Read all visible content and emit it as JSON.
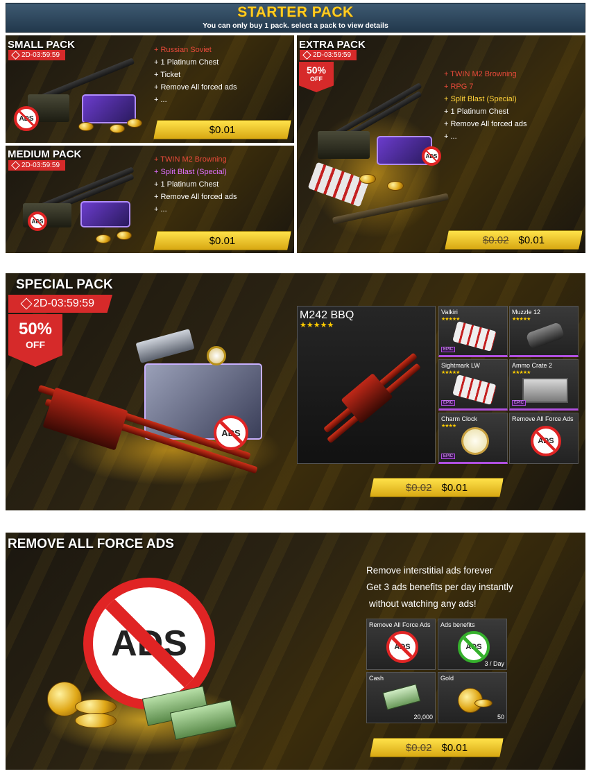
{
  "header": {
    "title": "STARTER PACK",
    "subtitle": "You can only buy 1 pack. select a pack to view details"
  },
  "small_pack": {
    "title": "SMALL PACK",
    "timer": "2D-03:59:59",
    "items": [
      "+ Russian Soviet",
      "+ 1 Platinum Chest",
      "+ Ticket",
      "+ Remove All forced ads",
      "+ ..."
    ],
    "price": "$0.01",
    "ads_icon_text": "ADS"
  },
  "medium_pack": {
    "title": "MEDIUM PACK",
    "timer": "2D-03:59:59",
    "items": [
      "+ TWIN M2 Browning",
      "+ Split Blast (Special)",
      "+ 1 Platinum Chest",
      "+ Remove All forced ads",
      "+ ..."
    ],
    "price": "$0.01",
    "ads_icon_text": "ADS"
  },
  "extra_pack": {
    "title": "EXTRA PACK",
    "timer": "2D-03:59:59",
    "discount_pct": "50%",
    "discount_off": "OFF",
    "items": [
      "+ TWIN M2 Browning",
      "+ RPG 7",
      "+ Split Blast (Special)",
      "+ 1 Platinum Chest",
      "+ Remove All forced ads",
      "+ ..."
    ],
    "old_price": "$0.02",
    "price": "$0.01",
    "ads_icon_text": "ADS"
  },
  "special_pack": {
    "title": "SPECIAL PACK",
    "timer": "2D-03:59:59",
    "discount_pct": "50%",
    "discount_off": "OFF",
    "main_item": {
      "name": "M242 BBQ",
      "stars": "★★★★★"
    },
    "grid": [
      {
        "name": "Valkiri",
        "stars": "★★★★★",
        "tag": "EPIC"
      },
      {
        "name": "Muzzle 12",
        "stars": "★★★★★",
        "tag": ""
      },
      {
        "name": "Sightmark LW",
        "stars": "★★★★★",
        "tag": "EPIC"
      },
      {
        "name": "Ammo Crate 2",
        "stars": "★★★★★",
        "tag": "EPIC"
      },
      {
        "name": "Charm Clock",
        "stars": "★★★★",
        "tag": "EPIC"
      },
      {
        "name": "Remove All Force Ads",
        "stars": "",
        "tag": ""
      }
    ],
    "old_price": "$0.02",
    "price": "$0.01",
    "ads_icon_text": "ADS"
  },
  "remove_ads": {
    "title": "REMOVE ALL FORCE ADS",
    "big_icon_text": "ADS",
    "desc": [
      "Remove interstitial ads forever",
      "Get 3 ads benefits per day instantly",
      "without watching any ads!"
    ],
    "grid": [
      {
        "name": "Remove All Force Ads",
        "qty": "",
        "icon": "ADS"
      },
      {
        "name": "Ads benefits",
        "qty": "3 / Day",
        "icon": "ADS"
      },
      {
        "name": "Cash",
        "qty": "20,000",
        "icon": ""
      },
      {
        "name": "Gold",
        "qty": "50",
        "icon": ""
      }
    ],
    "old_price": "$0.02",
    "price": "$0.01"
  },
  "colors": {
    "accent_gold": "#ffcc22",
    "timer_red": "#d62a2a",
    "header_blue": "#2f4a62"
  }
}
